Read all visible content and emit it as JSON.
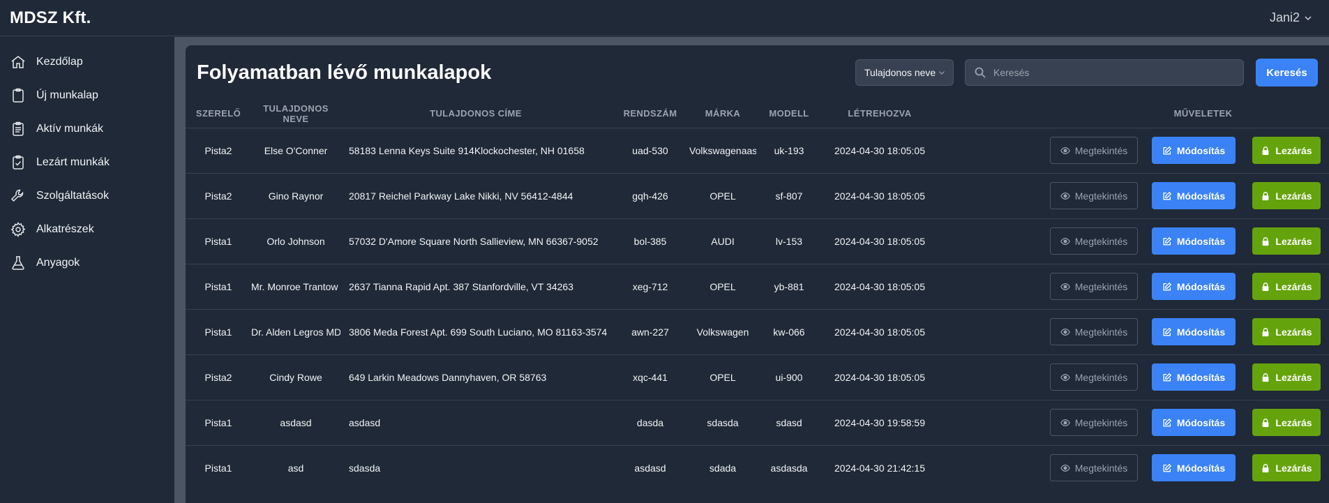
{
  "app": {
    "brand": "MDSZ Kft.",
    "user": "Jani2"
  },
  "sidebar": {
    "items": [
      {
        "label": "Kezdőlap",
        "icon": "home-icon"
      },
      {
        "label": "Új munkalap",
        "icon": "clipboard-icon"
      },
      {
        "label": "Aktív munkák",
        "icon": "clipboard-list-icon"
      },
      {
        "label": "Lezárt munkák",
        "icon": "clipboard-check-icon"
      },
      {
        "label": "Szolgáltatások",
        "icon": "wrench-icon"
      },
      {
        "label": "Alkatrészek",
        "icon": "gear-icon"
      },
      {
        "label": "Anyagok",
        "icon": "flask-icon"
      }
    ]
  },
  "main": {
    "title": "Folyamatban lévő munkalapok",
    "filter_value": "Tulajdonos neve",
    "search_placeholder": "Keresés",
    "search_button": "Keresés",
    "columns": [
      "Szerelő",
      "Tulajdonos neve",
      "Tulajdonos címe",
      "Rendszám",
      "Márka",
      "Modell",
      "Létrehozva",
      "Műveletek"
    ],
    "actions": {
      "view": "Megtekintés",
      "edit": "Módosítás",
      "close": "Lezárás"
    },
    "rows": [
      {
        "mechanic": "Pista2",
        "owner": "Else O'Conner",
        "address": "58183 Lenna Keys Suite 914Klockochester, NH 01658",
        "plate": "uad-530",
        "brand": "Volkswagenaasd",
        "model": "uk-193",
        "created": "2024-04-30 18:05:05"
      },
      {
        "mechanic": "Pista2",
        "owner": "Gino Raynor",
        "address": "20817 Reichel Parkway Lake Nikki, NV 56412-4844",
        "plate": "gqh-426",
        "brand": "OPEL",
        "model": "sf-807",
        "created": "2024-04-30 18:05:05"
      },
      {
        "mechanic": "Pista1",
        "owner": "Orlo Johnson",
        "address": "57032 D'Amore Square North Sallieview, MN 66367-9052",
        "plate": "bol-385",
        "brand": "AUDI",
        "model": "lv-153",
        "created": "2024-04-30 18:05:05"
      },
      {
        "mechanic": "Pista1",
        "owner": "Mr. Monroe Trantow V",
        "address": "2637 Tianna Rapid Apt. 387 Stanfordville, VT 34263",
        "plate": "xeg-712",
        "brand": "OPEL",
        "model": "yb-881",
        "created": "2024-04-30 18:05:05"
      },
      {
        "mechanic": "Pista1",
        "owner": "Dr. Alden Legros MD",
        "address": "3806 Meda Forest Apt. 699 South Luciano, MO 81163-3574",
        "plate": "awn-227",
        "brand": "Volkswagen",
        "model": "kw-066",
        "created": "2024-04-30 18:05:05"
      },
      {
        "mechanic": "Pista2",
        "owner": "Cindy Rowe",
        "address": "649 Larkin Meadows Dannyhaven, OR 58763",
        "plate": "xqc-441",
        "brand": "OPEL",
        "model": "ui-900",
        "created": "2024-04-30 18:05:05"
      },
      {
        "mechanic": "Pista1",
        "owner": "asdasd",
        "address": "asdasd",
        "plate": "dasda",
        "brand": "sdasda",
        "model": "sdasd",
        "created": "2024-04-30 19:58:59"
      },
      {
        "mechanic": "Pista1",
        "owner": "asd",
        "address": "sdasda",
        "plate": "asdasd",
        "brand": "sdada",
        "model": "asdasda",
        "created": "2024-04-30 21:42:15"
      }
    ]
  }
}
